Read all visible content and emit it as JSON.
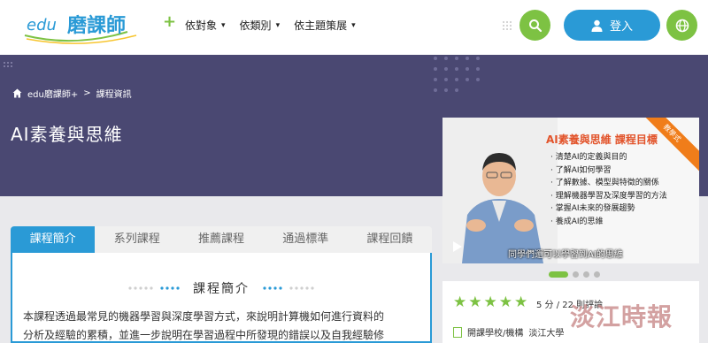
{
  "header": {
    "logo_text": "edu磨課師+",
    "nav": [
      {
        "label": "依對象"
      },
      {
        "label": "依類別"
      },
      {
        "label": "依主題策展"
      }
    ],
    "login_label": "登入"
  },
  "hero": {
    "breadcrumb": {
      "home": "edu磨課師+",
      "separator": ">",
      "current": "課程資訊"
    },
    "title": "AI素養與思維"
  },
  "tabs": [
    {
      "label": "課程簡介",
      "active": true
    },
    {
      "label": "系列課程",
      "active": false
    },
    {
      "label": "推薦課程",
      "active": false
    },
    {
      "label": "通過標準",
      "active": false
    },
    {
      "label": "課程回饋",
      "active": false
    }
  ],
  "intro": {
    "heading": "課程簡介",
    "line1": "本課程透過最常見的機器學習與深度學習方式，來說明計算機如何進行資料的",
    "line2": "分析及經驗的累積，並進一步說明在學習過程中所發現的錯誤以及自我經驗修"
  },
  "video": {
    "ribbon": "教學式",
    "title": "AI素養與思維 課程目標",
    "objectives": [
      "清楚AI的定義與目的",
      "了解AI如何學習",
      "了解數據、模型與特徵的關係",
      "理解機器學習及深度學習的方法",
      "掌握AI未來的發展趨勢",
      "養成AI的思維"
    ],
    "subtitle": "同學們還可以學習到AI的思維"
  },
  "rating": {
    "stars": 5,
    "text": "5 分 / 22 則評論"
  },
  "school": {
    "label": "開課學校/機構",
    "value": "淡江大學"
  },
  "watermark": "淡江時報",
  "colors": {
    "brand_blue": "#2a9ad6",
    "brand_green": "#7dc243",
    "hero_bg": "#4a4872",
    "ribbon_orange": "#f07d1a"
  }
}
